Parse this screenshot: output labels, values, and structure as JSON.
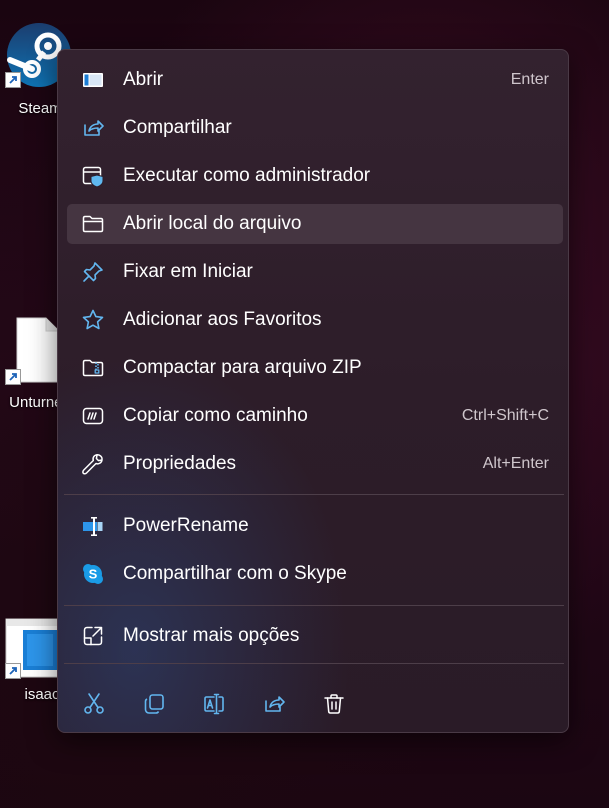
{
  "desktop": {
    "icons": [
      {
        "label": "Steam",
        "icon": "steam-icon"
      },
      {
        "label": "Unturned",
        "icon": "file-icon"
      },
      {
        "label": "isaac",
        "icon": "app-file-icon"
      }
    ]
  },
  "menu": {
    "items": [
      {
        "label": "Abrir",
        "shortcut": "Enter",
        "icon": "open-app-icon"
      },
      {
        "label": "Compartilhar",
        "shortcut": "",
        "icon": "share-icon"
      },
      {
        "label": "Executar como administrador",
        "shortcut": "",
        "icon": "admin-shield-icon"
      },
      {
        "label": "Abrir local do arquivo",
        "shortcut": "",
        "icon": "folder-icon"
      },
      {
        "label": "Fixar em Iniciar",
        "shortcut": "",
        "icon": "pin-icon"
      },
      {
        "label": "Adicionar aos Favoritos",
        "shortcut": "",
        "icon": "star-icon"
      },
      {
        "label": "Compactar para arquivo ZIP",
        "shortcut": "",
        "icon": "zip-folder-icon"
      },
      {
        "label": "Copiar como caminho",
        "shortcut": "Ctrl+Shift+C",
        "icon": "copy-path-icon"
      },
      {
        "label": "Propriedades",
        "shortcut": "Alt+Enter",
        "icon": "wrench-icon"
      }
    ],
    "extensions": [
      {
        "label": "PowerRename",
        "icon": "powerrename-icon"
      },
      {
        "label": "Compartilhar com o Skype",
        "icon": "skype-icon"
      }
    ],
    "more": {
      "label": "Mostrar mais opções",
      "icon": "show-more-icon"
    },
    "toolbar": [
      {
        "name": "cut",
        "icon": "scissors-icon"
      },
      {
        "name": "copy",
        "icon": "copy-icon"
      },
      {
        "name": "rename",
        "icon": "rename-icon"
      },
      {
        "name": "share",
        "icon": "share-icon"
      },
      {
        "name": "delete",
        "icon": "trash-icon"
      }
    ]
  },
  "colors": {
    "accent": "#5fb8f0",
    "menu_bg": "#2f1f2b",
    "hover_bg": "#453541",
    "text": "#ffffff",
    "shortcut_text": "#cfc6cc"
  }
}
